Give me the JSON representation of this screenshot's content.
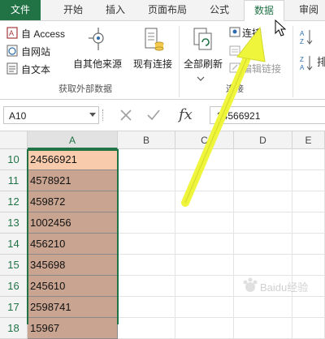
{
  "tabs": {
    "file": "文件",
    "home": "开始",
    "insert": "插入",
    "page_layout": "页面布局",
    "formulas": "公式",
    "data": "数据",
    "review": "审阅"
  },
  "ribbon": {
    "from_access": "自 Access",
    "from_web": "自网站",
    "from_text": "自文本",
    "from_other": "自其他来源",
    "existing_connections": "现有连接",
    "group_external": "获取外部数据",
    "refresh_all": "全部刷新",
    "connections": "连接",
    "edit_links": "编辑链接",
    "group_connections": "连接"
  },
  "formula_bar": {
    "name_box": "A10",
    "fx": "fx",
    "value": "24566921"
  },
  "grid": {
    "columns": [
      "A",
      "B",
      "C",
      "D",
      "E"
    ],
    "rows": [
      {
        "num": "10",
        "a": "24566921"
      },
      {
        "num": "11",
        "a": "4578921"
      },
      {
        "num": "12",
        "a": "459872"
      },
      {
        "num": "13",
        "a": "1002456"
      },
      {
        "num": "14",
        "a": "456210"
      },
      {
        "num": "15",
        "a": "345698"
      },
      {
        "num": "16",
        "a": "245610"
      },
      {
        "num": "17",
        "a": "2598741"
      },
      {
        "num": "18",
        "a": "15967"
      }
    ]
  },
  "colors": {
    "excel_green": "#217346",
    "cell_fill": "#c9a591",
    "active_cell_fill": "#f8cbad",
    "arrow": "#eef53a"
  },
  "watermark": "Baidu经验"
}
